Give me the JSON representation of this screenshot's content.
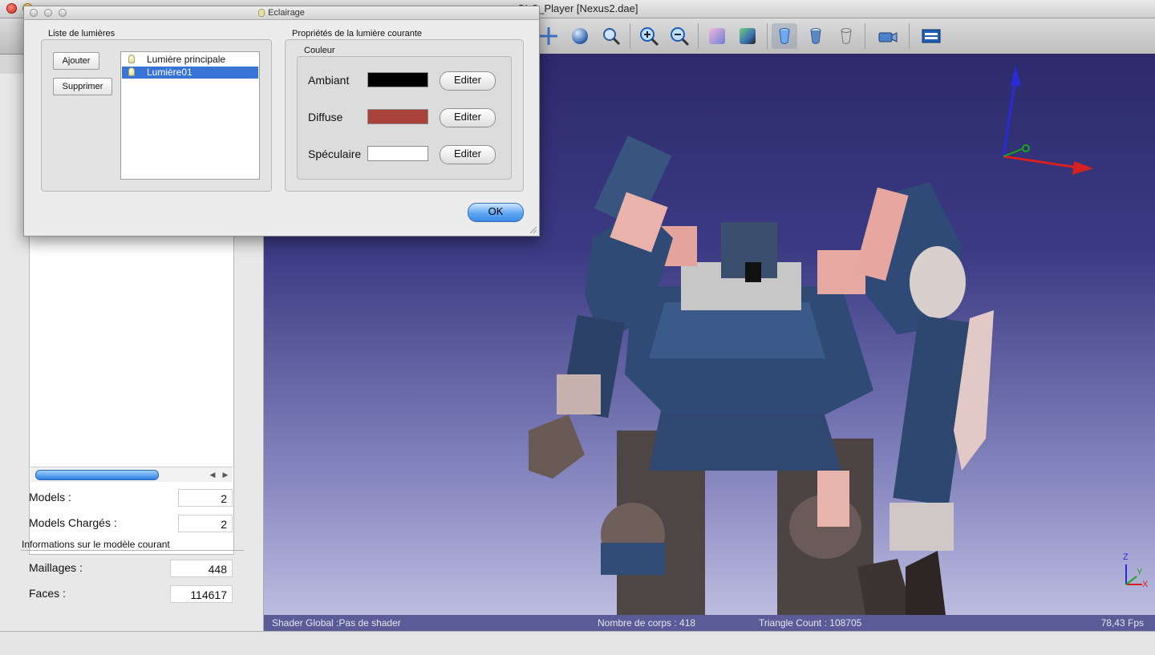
{
  "window": {
    "title": "GLC_Player [Nexus2.dae]"
  },
  "toolbar": {
    "icons": [
      "move-icon",
      "orbit-icon",
      "zoom-region-icon",
      "zoom-in-icon",
      "zoom-out-icon",
      "shading-icon",
      "texture-icon",
      "cylinder-blue-icon",
      "cylinder-outline-icon",
      "cylinder-wire-icon",
      "camera-settings-icon",
      "properties-icon"
    ]
  },
  "left_panel": {
    "models_label": "Models :",
    "models_value": "2",
    "loaded_label": "Models Chargés :",
    "loaded_value": "2",
    "info_heading": "Informations sur le modèle courant",
    "meshes_label": "Maillages :",
    "meshes_value": "448",
    "faces_label": "Faces :",
    "faces_value": "114617"
  },
  "status_bar": {
    "shader": "Shader Global :Pas de shader",
    "bodies": "Nombre de corps : 418",
    "triangles": "Triangle Count : 108705",
    "fps": "78,43 Fps"
  },
  "dialog": {
    "title": "Eclairage",
    "lights_group": "Liste de lumières",
    "add_button": "Ajouter",
    "remove_button": "Supprimer",
    "lights": [
      {
        "label": "Lumière principale",
        "selected": false
      },
      {
        "label": "Lumière01",
        "selected": true
      }
    ],
    "props_group": "Propriétés de la lumière courante",
    "color_group": "Couleur",
    "colors": [
      {
        "label": "Ambiant",
        "swatch": "#000000",
        "button": "Editer"
      },
      {
        "label": "Diffuse",
        "swatch": "#a8423a",
        "button": "Editer"
      },
      {
        "label": "Spéculaire",
        "swatch": "#ffffff",
        "button": "Editer"
      }
    ],
    "ok_button": "OK"
  },
  "axis_gizmo": {
    "labels": [
      "Z",
      "Y",
      "X"
    ]
  }
}
